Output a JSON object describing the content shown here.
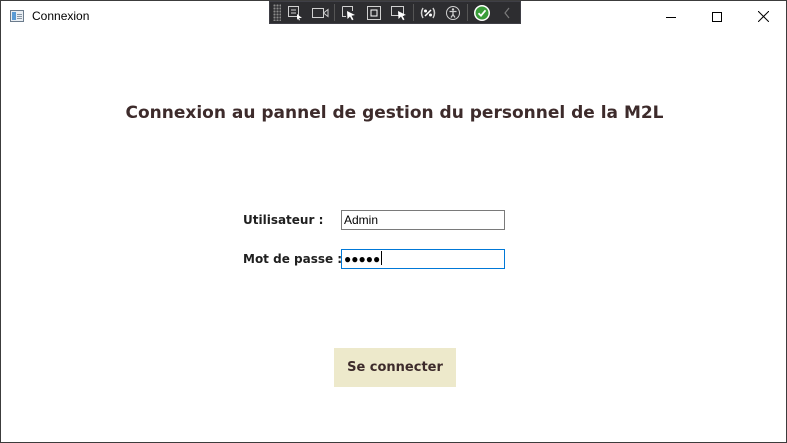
{
  "window": {
    "title": "Connexion"
  },
  "debug_toolbar": {
    "icons": [
      "select-element-icon",
      "video-icon",
      "pointer-icon",
      "frame-icon",
      "track-focus-icon",
      "binding-icon",
      "accessibility-icon",
      "check-icon",
      "collapse-chevron-icon"
    ]
  },
  "main": {
    "heading": "Connexion au pannel de gestion du personnel de la M2L",
    "user_label": "Utilisateur :",
    "user_value": "Admin",
    "password_label": "Mot de passe :",
    "password_mask": "●●●●●",
    "login_button": "Se connecter"
  },
  "colors": {
    "heading": "#3d2b2b",
    "button_bg": "#ede9cb",
    "focus_border": "#0078d7",
    "toolbar_bg": "#2d2d30"
  }
}
